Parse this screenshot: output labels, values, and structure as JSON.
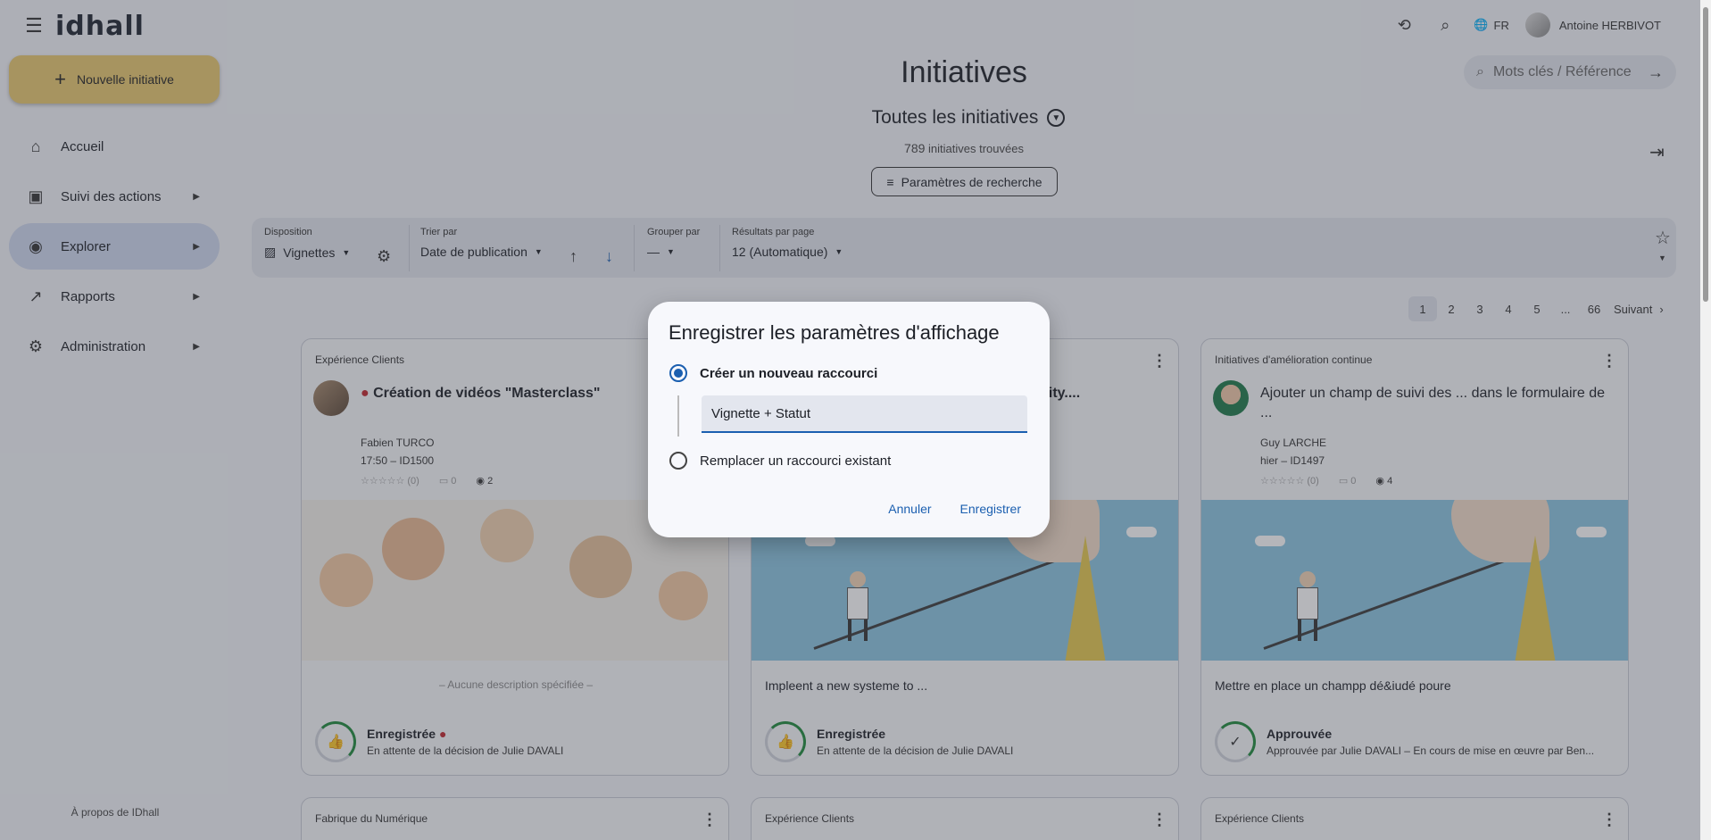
{
  "app": {
    "logo_text": "idhall",
    "about": "À propos de IDhall"
  },
  "header": {
    "lang": "FR",
    "user_name": "Antoine HERBIVOT"
  },
  "sidebar": {
    "new_button": "Nouvelle initiative",
    "items": [
      {
        "label": "Accueil",
        "icon": "home-icon"
      },
      {
        "label": "Suivi des actions",
        "icon": "clipboard-icon"
      },
      {
        "label": "Explorer",
        "icon": "compass-icon"
      },
      {
        "label": "Rapports",
        "icon": "chart-icon"
      },
      {
        "label": "Administration",
        "icon": "gear-icon"
      }
    ]
  },
  "main": {
    "title": "Initiatives",
    "search_placeholder": "Mots clés / Référence",
    "subtitle": "Toutes les initiatives",
    "count_number": "789",
    "count_label": "initiatives trouvées",
    "params_button": "Paramètres de recherche"
  },
  "toolbar": {
    "disposition_label": "Disposition",
    "disposition_value": "Vignettes",
    "sort_label": "Trier par",
    "sort_value": "Date de publication",
    "group_label": "Grouper par",
    "group_value": "—",
    "results_label": "Résultats par page",
    "results_value": "12 (Automatique)"
  },
  "pagination": {
    "pages": [
      "1",
      "2",
      "3",
      "4",
      "5",
      "...",
      "66"
    ],
    "next": "Suivant"
  },
  "cards": [
    {
      "category": "Expérience Clients",
      "title": "Création de vidéos \"Masterclass\"",
      "author": "Fabien TURCO",
      "meta": "17:50 – ID1500",
      "rating": "☆☆☆☆☆ (0)",
      "comments": "0",
      "views": "2",
      "description": "– Aucune description spécifiée –",
      "status": "Enregistrée",
      "status_detail": "En attente de la décision de Julie DAVALI"
    },
    {
      "category": "",
      "title": "quality....",
      "description": "Impleent a new systeme to ...",
      "status": "Enregistrée",
      "status_detail": "En attente de la décision de Julie DAVALI"
    },
    {
      "category": "Initiatives d'amélioration continue",
      "title": "Ajouter un champ de suivi des ... dans le formulaire de ...",
      "author": "Guy LARCHE",
      "meta": "hier – ID1497",
      "rating": "☆☆☆☆☆ (0)",
      "comments": "0",
      "views": "4",
      "description": "Mettre en place un champp dé&iudé poure",
      "status": "Approuvée",
      "status_detail": "Approuvée par Julie DAVALI – En cours de mise en œuvre par Ben..."
    }
  ],
  "next_row": [
    "Fabrique du Numérique",
    "Expérience Clients",
    "Expérience Clients"
  ],
  "dialog": {
    "title": "Enregistrer les paramètres d'affichage",
    "option_new": "Créer un nouveau raccourci",
    "input_value": "Vignette + Statut",
    "option_replace": "Remplacer un raccourci existant",
    "cancel": "Annuler",
    "save": "Enregistrer"
  },
  "colors": {
    "accent": "#1b5fb0",
    "new_button": "#e8c86e",
    "active_nav": "#cfd9ef"
  }
}
